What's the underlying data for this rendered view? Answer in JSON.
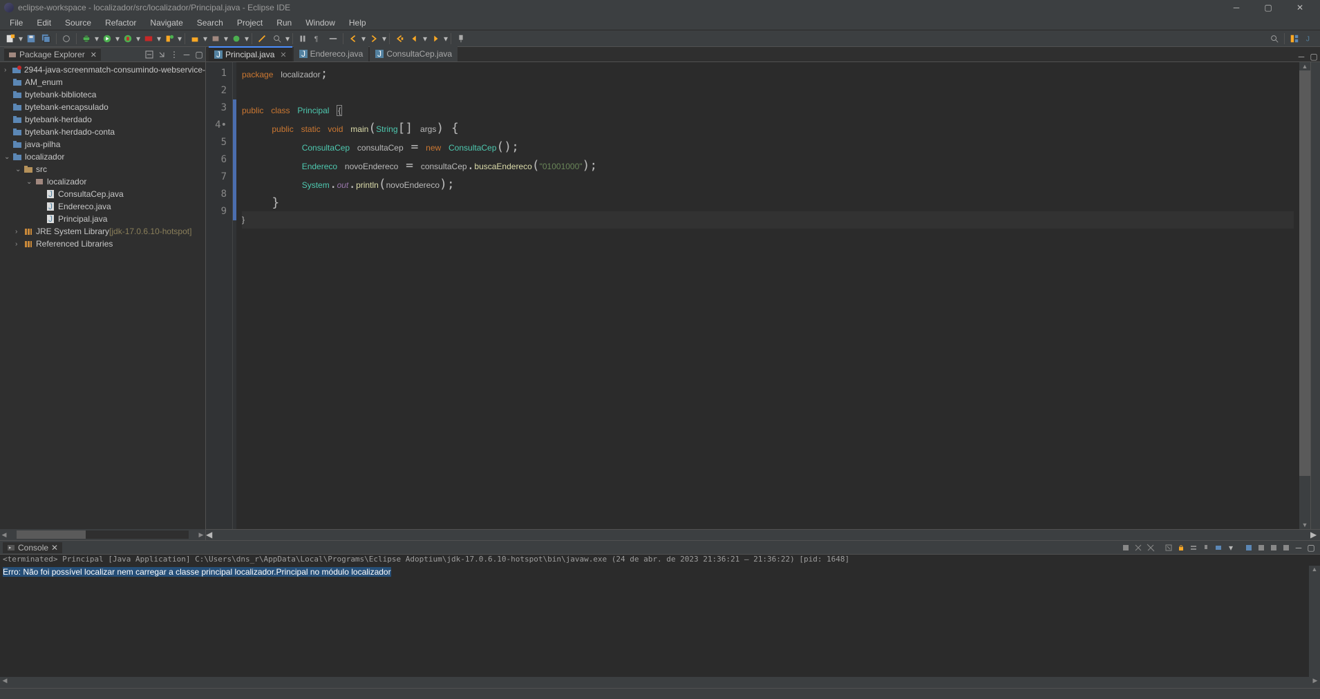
{
  "title": "eclipse-workspace - localizador/src/localizador/Principal.java - Eclipse IDE",
  "menu": [
    "File",
    "Edit",
    "Source",
    "Refactor",
    "Navigate",
    "Search",
    "Project",
    "Run",
    "Window",
    "Help"
  ],
  "package_explorer": {
    "title": "Package Explorer",
    "projects": [
      {
        "name": "2944-java-screenmatch-consumindo-webservice-",
        "icon": "proj-red",
        "expand": ">"
      },
      {
        "name": "AM_enum",
        "icon": "proj"
      },
      {
        "name": "bytebank-biblioteca",
        "icon": "proj"
      },
      {
        "name": "bytebank-encapsulado",
        "icon": "proj"
      },
      {
        "name": "bytebank-herdado",
        "icon": "proj"
      },
      {
        "name": "bytebank-herdado-conta",
        "icon": "proj"
      },
      {
        "name": "java-pilha",
        "icon": "proj"
      },
      {
        "name": "localizador",
        "icon": "proj-open",
        "expand": "v",
        "children": [
          {
            "name": "src",
            "icon": "folder",
            "expand": "v",
            "indent": 1,
            "children": [
              {
                "name": "localizador",
                "icon": "pkg",
                "expand": "v",
                "indent": 2,
                "children": [
                  {
                    "name": "ConsultaCep.java",
                    "icon": "java",
                    "indent": 3
                  },
                  {
                    "name": "Endereco.java",
                    "icon": "java",
                    "indent": 3
                  },
                  {
                    "name": "Principal.java",
                    "icon": "java",
                    "indent": 3
                  }
                ]
              }
            ]
          },
          {
            "name": "JRE System Library",
            "suffix": "[jdk-17.0.6.10-hotspot]",
            "icon": "lib",
            "expand": ">",
            "indent": 1
          },
          {
            "name": "Referenced Libraries",
            "icon": "lib",
            "expand": ">",
            "indent": 1
          }
        ]
      }
    ]
  },
  "tabs": [
    {
      "label": "Principal.java",
      "active": true
    },
    {
      "label": "Endereco.java",
      "active": false
    },
    {
      "label": "ConsultaCep.java",
      "active": false
    }
  ],
  "code": {
    "lines": [
      "1",
      "2",
      "3",
      "4",
      "5",
      "6",
      "7",
      "8",
      "9"
    ],
    "l4_marker": "•"
  },
  "tokens": {
    "package": "package",
    "class": "class",
    "public": "public",
    "static": "static",
    "void": "void",
    "new": "new",
    "pkgname": "localizador",
    "clsname": "Principal",
    "main": "main",
    "String": "String",
    "args": "args",
    "ConsultaCep": "ConsultaCep",
    "consultaCep": "consultaCep",
    "Endereco": "Endereco",
    "novoEndereco": "novoEndereco",
    "buscaEndereco": "buscaEndereco",
    "cep": "\"01001000\"",
    "System": "System",
    "out": "out",
    "println": "println"
  },
  "console": {
    "title": "Console",
    "info": "<terminated> Principal [Java Application] C:\\Users\\dns_r\\AppData\\Local\\Programs\\Eclipse Adoptium\\jdk-17.0.6.10-hotspot\\bin\\javaw.exe  (24 de abr. de 2023 21:36:21 – 21:36:22) [pid: 1648]",
    "error": "Erro: Não foi possível localizar nem carregar a classe principal localizador.Principal no módulo localizador"
  }
}
